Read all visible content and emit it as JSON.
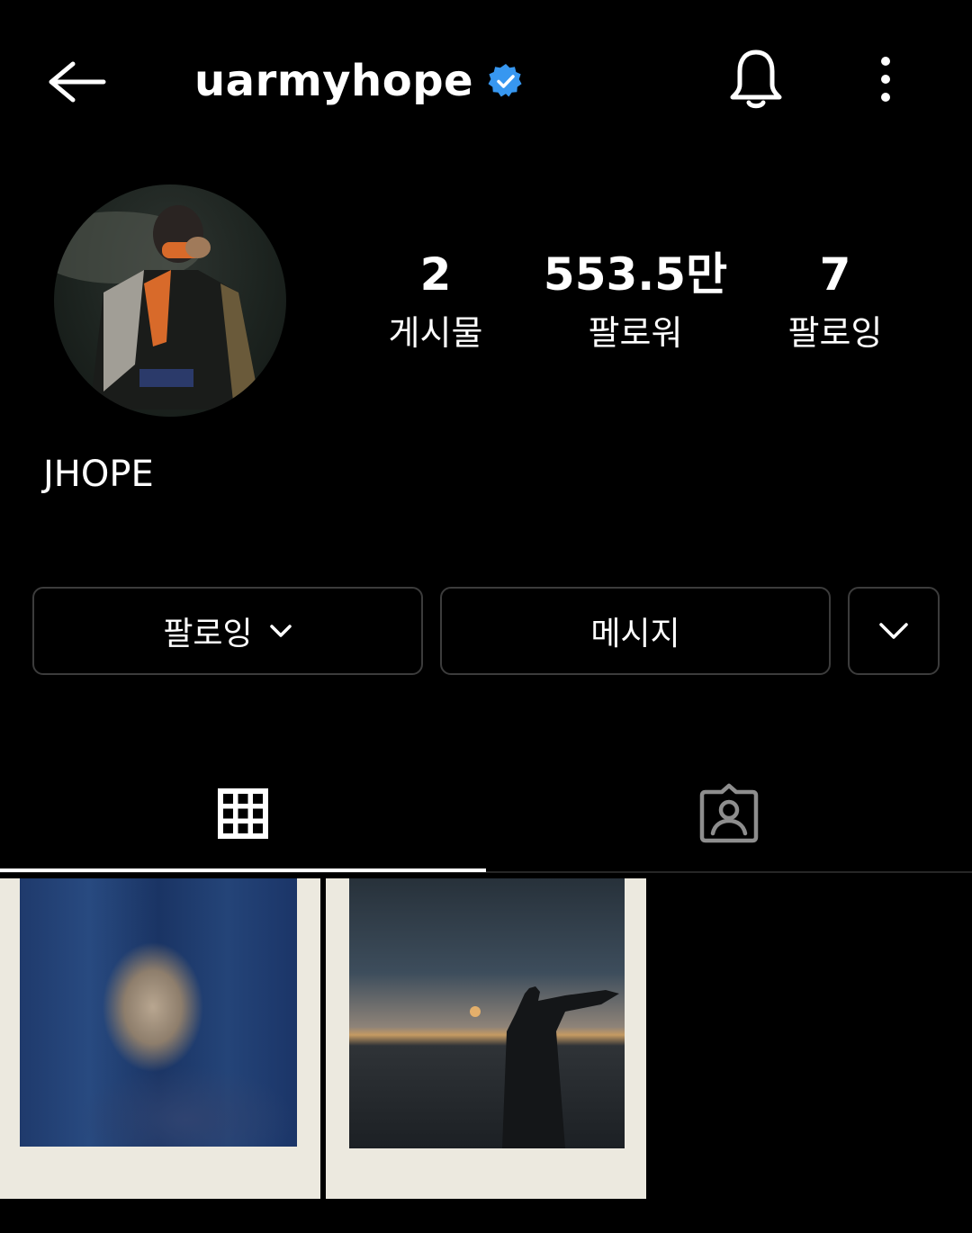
{
  "header": {
    "username": "uarmyhope",
    "verified": true,
    "icons": {
      "back": "arrow-left-icon",
      "verified": "verified-badge-icon",
      "notifications": "bell-icon",
      "more": "more-vertical-icon"
    }
  },
  "profile": {
    "display_name": "JHOPE",
    "stats": [
      {
        "value": "2",
        "label": "게시물"
      },
      {
        "value": "553.5만",
        "label": "팔로워"
      },
      {
        "value": "7",
        "label": "팔로잉"
      }
    ]
  },
  "actions": {
    "follow_label": "팔로잉",
    "message_label": "메시지"
  },
  "tabs": {
    "active": "posts",
    "items": [
      "grid-icon",
      "tagged-icon"
    ]
  },
  "colors": {
    "background": "#000000",
    "text": "#ffffff",
    "verified_blue": "#3797f0",
    "border": "#3c3c3c"
  }
}
